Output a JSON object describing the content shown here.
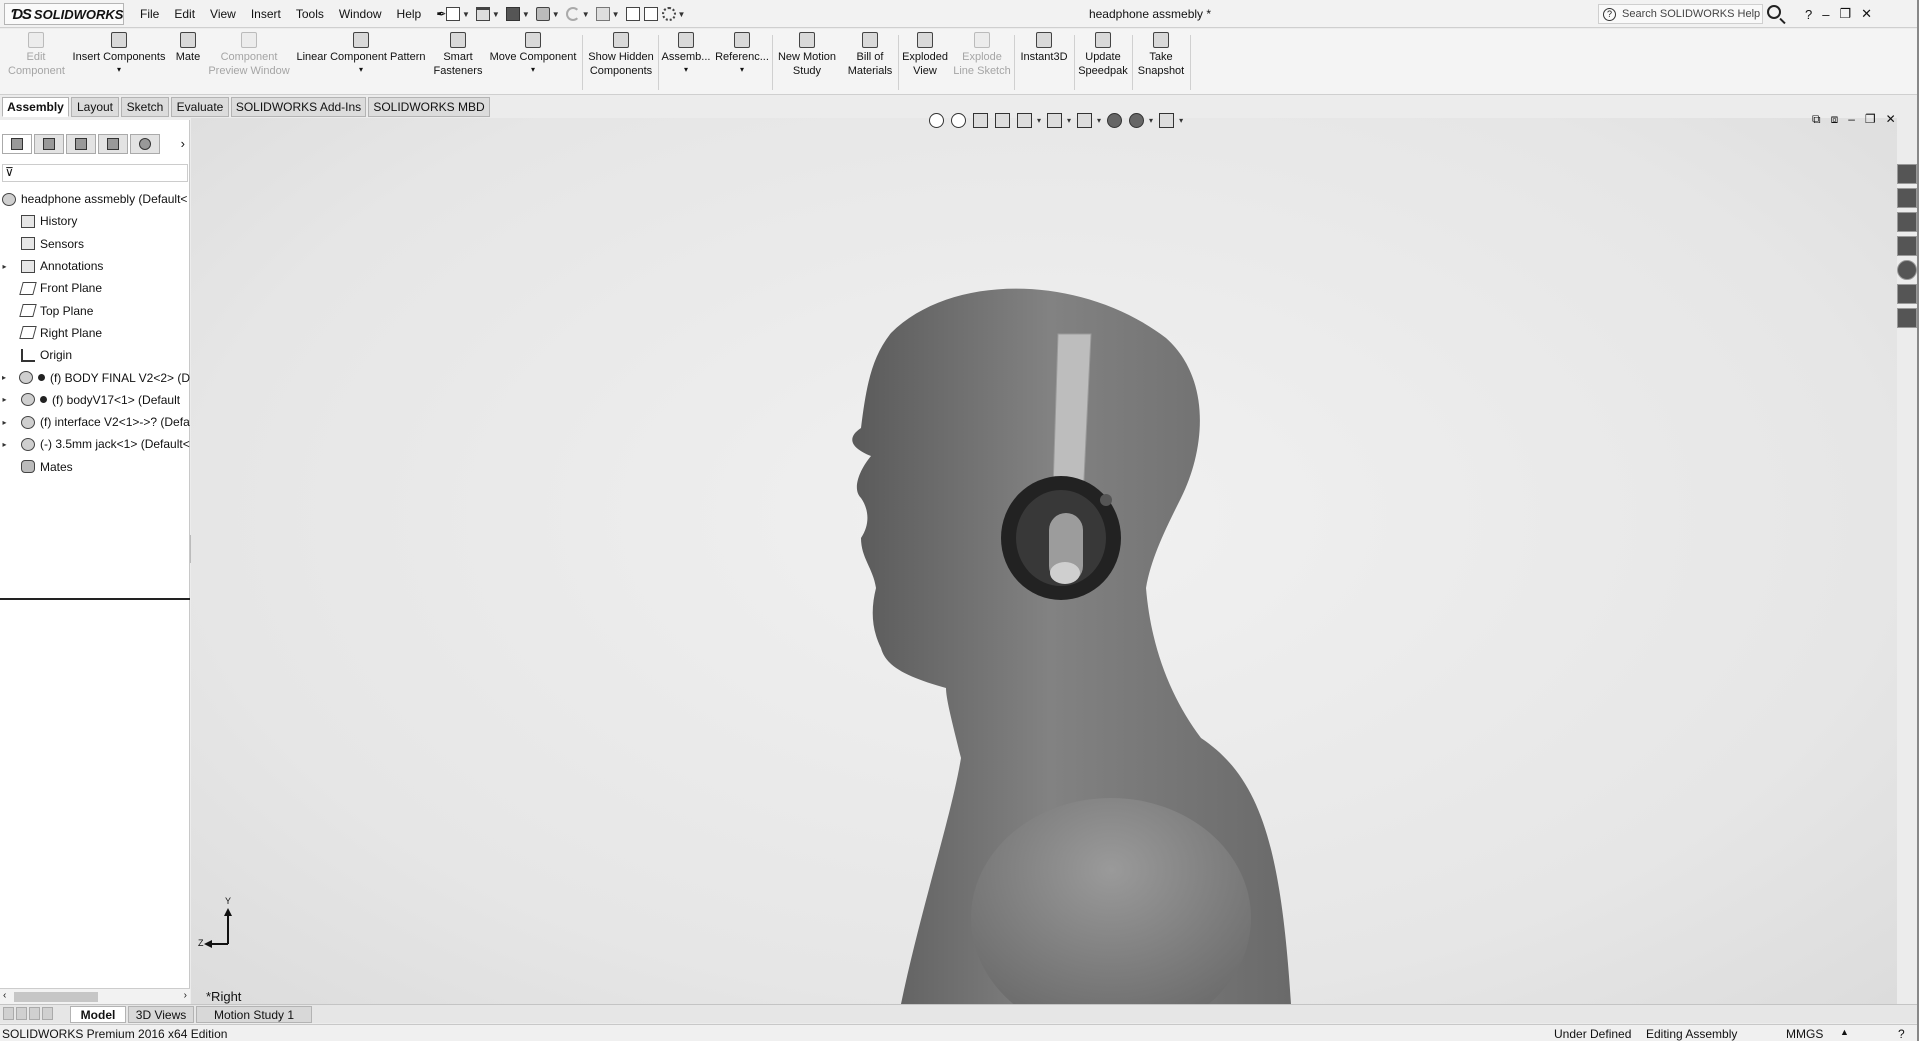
{
  "app": {
    "logo_text": "SOLIDWORKS",
    "document_title": "headphone assmebly *",
    "menu": [
      "File",
      "Edit",
      "View",
      "Insert",
      "Tools",
      "Window",
      "Help"
    ],
    "help_search_placeholder": "Search SOLIDWORKS Help",
    "window_controls": [
      "?",
      "–",
      "❐",
      "✕"
    ]
  },
  "command_manager": {
    "buttons": [
      {
        "label": "Edit Component",
        "enabled": false
      },
      {
        "label": "Insert Components",
        "enabled": true
      },
      {
        "label": "Mate",
        "enabled": true
      },
      {
        "label": "Component Preview Window",
        "enabled": false
      },
      {
        "label": "Linear Component Pattern",
        "enabled": true
      },
      {
        "label": "Smart Fasteners",
        "enabled": true
      },
      {
        "label": "Move Component",
        "enabled": true
      },
      {
        "label": "Show Hidden Components",
        "enabled": true
      },
      {
        "label": "Assemb...",
        "enabled": true
      },
      {
        "label": "Referenc...",
        "enabled": true
      },
      {
        "label": "New Motion Study",
        "enabled": true
      },
      {
        "label": "Bill of Materials",
        "enabled": true
      },
      {
        "label": "Exploded View",
        "enabled": true
      },
      {
        "label": "Explode Line Sketch",
        "enabled": false
      },
      {
        "label": "Instant3D",
        "enabled": true
      },
      {
        "label": "Update Speedpak",
        "enabled": true
      },
      {
        "label": "Take Snapshot",
        "enabled": true
      }
    ],
    "tabs": [
      "Assembly",
      "Layout",
      "Sketch",
      "Evaluate",
      "SOLIDWORKS Add-Ins",
      "SOLIDWORKS MBD"
    ],
    "active_tab": "Assembly"
  },
  "feature_manager": {
    "root": "headphone assmebly  (Default<",
    "items": [
      {
        "label": "History",
        "type": "folder"
      },
      {
        "label": "Sensors",
        "type": "folder"
      },
      {
        "label": "Annotations",
        "type": "folder",
        "expandable": true
      },
      {
        "label": "Front Plane",
        "type": "plane"
      },
      {
        "label": "Top Plane",
        "type": "plane"
      },
      {
        "label": "Right Plane",
        "type": "plane"
      },
      {
        "label": "Origin",
        "type": "origin"
      },
      {
        "label": "(f) BODY FINAL V2<2> (D",
        "type": "component",
        "expandable": true,
        "fixed_dot": true
      },
      {
        "label": "(f) bodyV17<1> (Default",
        "type": "component",
        "expandable": true,
        "fixed_dot": true
      },
      {
        "label": "(f) interface V2<1>->? (Defa",
        "type": "component",
        "expandable": true
      },
      {
        "label": "(-) 3.5mm jack<1> (Default<",
        "type": "component",
        "expandable": true
      },
      {
        "label": "Mates",
        "type": "mates"
      }
    ]
  },
  "viewport": {
    "view_name": "*Right",
    "triad_axes": {
      "y": "Y",
      "z": "Z"
    },
    "viewport_controls": [
      "⧉",
      "⧈",
      "–",
      "❐",
      "✕"
    ]
  },
  "bottom_tabs": [
    "Model",
    "3D Views",
    "Motion Study 1"
  ],
  "active_bottom_tab": "Model",
  "status": {
    "edition": "SOLIDWORKS Premium 2016 x64 Edition",
    "state": "Under Defined",
    "mode": "Editing Assembly",
    "units": "MMGS"
  },
  "icons": {
    "tree": [
      "history-icon",
      "sensor-icon",
      "annotation-icon",
      "plane-icon",
      "origin-icon",
      "component-icon",
      "mate-icon"
    ],
    "toolbar": [
      "new-doc-icon",
      "open-icon",
      "save-icon",
      "print-icon",
      "undo-icon",
      "select-icon",
      "rebuild-icon",
      "options-icon"
    ]
  }
}
